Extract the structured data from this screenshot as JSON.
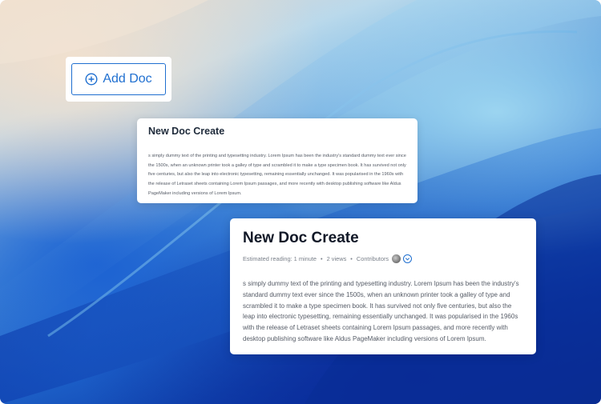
{
  "add_button": {
    "label": "Add Doc"
  },
  "card_small": {
    "title": "New Doc Create",
    "body": "s simply dummy text of the printing and typesetting industry. Lorem Ipsum has been the industry's standard dummy text ever since the 1500s, when an unknown printer took a galley of type and scrambled it to make a type specimen book. It has survived not only five centuries, but also the leap into electronic typesetting, remaining essentially unchanged. It was popularised in the 1960s with the release of Letraset sheets containing Lorem Ipsum passages, and more recently with desktop publishing software like Aldus PageMaker including versions of Lorem Ipsum."
  },
  "card_large": {
    "title": "New Doc Create",
    "meta": {
      "reading": "Estimated reading: 1 minute",
      "views": "2 views",
      "contributors": "Contributors",
      "separator": "•"
    },
    "body": "s simply dummy text of the printing and typesetting industry. Lorem Ipsum has been the industry's standard dummy text ever since the 1500s, when an unknown printer took a galley of type and scrambled it to make a type specimen book. It has survived not only five centuries, but also the leap into electronic typesetting, remaining essentially unchanged. It was popularised in the 1960s with the release of Letraset sheets containing Lorem Ipsum passages, and more recently with desktop publishing software like Aldus PageMaker including versions of Lorem Ipsum."
  },
  "colors": {
    "accent": "#1f6fd0",
    "title_dark": "#111827",
    "text_muted": "#555b66"
  },
  "icons": {
    "add": "plus-circle-icon",
    "expand": "chevron-down-icon",
    "avatar": "avatar"
  }
}
